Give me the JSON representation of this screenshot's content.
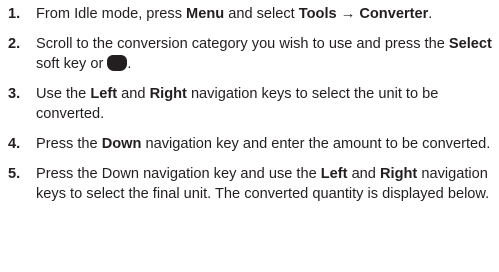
{
  "steps": [
    {
      "number": "1.",
      "t1": "From Idle mode, press ",
      "b1": "Menu",
      "t2": " and select ",
      "b2": "Tools",
      "arrow": " → ",
      "b3": "Converter",
      "t3": "."
    },
    {
      "number": "2.",
      "t1": "Scroll to the conversion category you wish to use and press the ",
      "b1": "Select",
      "t2": " soft key or ",
      "icon": "select-key-icon",
      "t3": "."
    },
    {
      "number": "3.",
      "t1": "Use the ",
      "b1": "Left",
      "t2": " and ",
      "b2": "Right",
      "t3": " navigation keys to select the unit to be converted."
    },
    {
      "number": "4.",
      "t1": "Press the ",
      "b1": "Down",
      "t2": " navigation key and enter the amount to be converted."
    },
    {
      "number": "5.",
      "t1": "Press the Down navigation key and use the ",
      "b1": "Left",
      "t2": " and ",
      "b2": "Right",
      "t3": " navigation keys to select the final unit. The converted quantity is displayed below."
    }
  ]
}
